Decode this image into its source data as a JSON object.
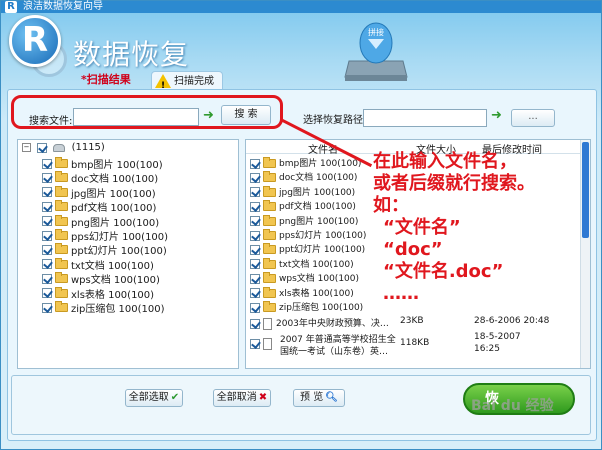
{
  "window": {
    "title": "浪洁数据恢复向导",
    "app_icon_letter": "R"
  },
  "header": {
    "logo_letter": "R",
    "app_title": "数据恢复"
  },
  "drive_graphic_label": "拼接",
  "tabs": {
    "scan_results": "*扫描结果",
    "scan_complete": "扫描完成"
  },
  "search": {
    "label": "搜索文件:",
    "value": "",
    "button": "搜 索"
  },
  "restore_path": {
    "label": "选择恢复路径",
    "value": "",
    "browse": "..."
  },
  "tree": {
    "root": {
      "label": "(1115)",
      "checked": true
    },
    "items": [
      {
        "label": "bmp图片 100(100)",
        "checked": true
      },
      {
        "label": "doc文档 100(100)",
        "checked": true
      },
      {
        "label": "jpg图片 100(100)",
        "checked": true
      },
      {
        "label": "pdf文档 100(100)",
        "checked": true
      },
      {
        "label": "png图片 100(100)",
        "checked": true
      },
      {
        "label": "pps幻灯片 100(100)",
        "checked": true
      },
      {
        "label": "ppt幻灯片 100(100)",
        "checked": true
      },
      {
        "label": "txt文档 100(100)",
        "checked": true
      },
      {
        "label": "wps文档 100(100)",
        "checked": true
      },
      {
        "label": "xls表格 100(100)",
        "checked": true
      },
      {
        "label": "zip压缩包 100(100)",
        "checked": true
      }
    ]
  },
  "file_list": {
    "columns": {
      "name": "文件名",
      "size": "文件大小",
      "modified": "最后修改时间"
    },
    "folders": [
      {
        "name": "bmp图片 100(100)",
        "checked": true
      },
      {
        "name": "doc文档 100(100)",
        "checked": true
      },
      {
        "name": "jpg图片 100(100)",
        "checked": true
      },
      {
        "name": "pdf文档 100(100)",
        "checked": true
      },
      {
        "name": "png图片 100(100)",
        "checked": true
      },
      {
        "name": "pps幻灯片 100(100)",
        "checked": true
      },
      {
        "name": "ppt幻灯片 100(100)",
        "checked": true
      },
      {
        "name": "txt文档 100(100)",
        "checked": true
      },
      {
        "name": "wps文档 100(100)",
        "checked": true
      },
      {
        "name": "xls表格 100(100)",
        "checked": true
      },
      {
        "name": "zip压缩包 100(100)",
        "checked": true
      }
    ],
    "files": [
      {
        "name": "2003年中央财政预算、决…",
        "size": "23KB",
        "modified": "28-6-2006 20:48",
        "checked": true
      },
      {
        "name_line1": "2007 年普通高等学校招生全",
        "name_line2": "国统一考试（山东卷）英…",
        "size": "118KB",
        "modified_line1": "18-5-2007",
        "modified_line2": "16:25",
        "checked": true
      }
    ]
  },
  "annotation": {
    "lines": [
      "在此输入文件名，",
      "或者后缀就行搜索。",
      "如：",
      "“文件名”",
      "“doc”",
      "“文件名.doc”",
      "……"
    ],
    "color": "#e0171e"
  },
  "buttons": {
    "select_all": "全部选取",
    "deselect_all": "全部取消",
    "preview": "预 览",
    "recover": "恢"
  },
  "watermark": "Bai du 经验"
}
